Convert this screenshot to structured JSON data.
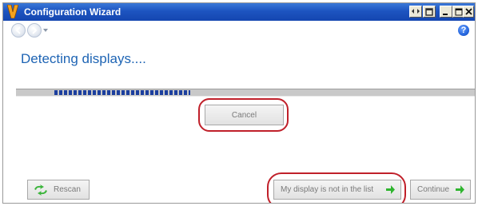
{
  "window": {
    "title": "Configuration Wizard",
    "app_icon": "v-logo-icon",
    "caption_buttons": [
      "restore-small-icon",
      "tile-icon",
      "minimize-icon",
      "maximize-icon",
      "close-icon"
    ]
  },
  "nav": {
    "back_icon": "back-arrow-icon",
    "forward_icon": "forward-arrow-icon",
    "dropdown_icon": "nav-dropdown-icon",
    "help_label": "?"
  },
  "content": {
    "heading": "Detecting displays....",
    "progress_fraction": 0.3
  },
  "buttons": {
    "cancel_label": "Cancel",
    "rescan_label": "Rescan",
    "not_listed_label": "My display is not in the list",
    "continue_label": "Continue"
  },
  "colors": {
    "title_bar": "#1d54c0",
    "heading": "#1e64b4",
    "progress": "#1c3f9e",
    "highlight": "#c0202a",
    "arrow_green": "#2fb52f"
  }
}
